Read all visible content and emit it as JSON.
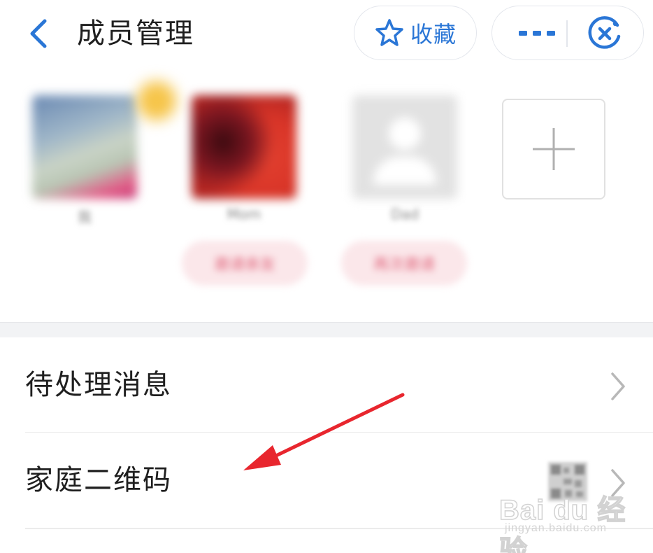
{
  "header": {
    "title": "成员管理",
    "favorite_label": "收藏"
  },
  "members": [
    {
      "name": "我",
      "tag": ""
    },
    {
      "name": "Mom",
      "tag": "邀请亲友"
    },
    {
      "name": "Dad",
      "tag": "再次邀请"
    }
  ],
  "list": {
    "items": [
      {
        "label": "待处理消息"
      },
      {
        "label": "家庭二维码"
      }
    ]
  },
  "watermark": {
    "logo": "Bai du 经验",
    "url": "jingyan.baidu.com"
  },
  "colors": {
    "accent": "#2a76d6",
    "annotation": "#e8262e",
    "tag_bg": "#fbe7ea"
  }
}
